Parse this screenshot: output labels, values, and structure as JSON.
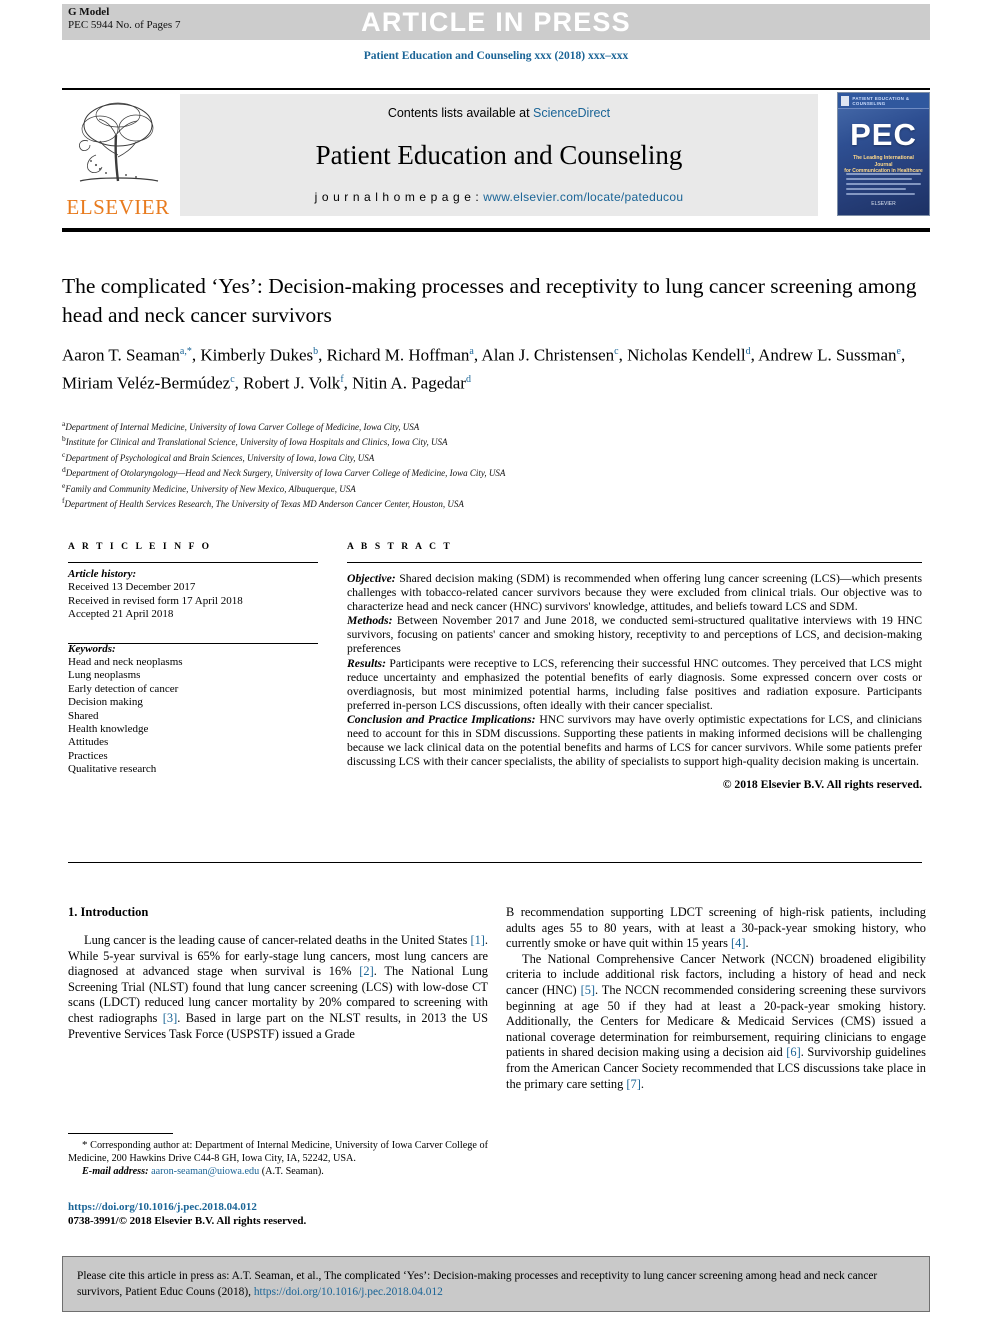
{
  "banner": {
    "text": "ARTICLE IN PRESS",
    "g_model_line1": "G Model",
    "g_model_line2": "PEC 5944 No. of Pages 7",
    "bg_color": "#cccccc"
  },
  "journal_ref": "Patient Education and Counseling xxx (2018) xxx–xxx",
  "masthead": {
    "publisher": "ELSEVIER",
    "publisher_color": "#E87B1E",
    "contents_prefix": "Contents lists available at ",
    "contents_link": "ScienceDirect",
    "journal_title": "Patient Education and Counseling",
    "homepage_label": "j o u r n a l  h o m e p a g e :  ",
    "homepage_url": "www.elsevier.com/locate/pateducou",
    "link_color": "#1a6496",
    "cover": {
      "header": "PATIENT EDUCATION & COUNSELING",
      "acronym": "PEC",
      "tagline_line1": "The Leading International Journal",
      "tagline_line2": "for Communication in Healthcare",
      "footer": "ELSEVIER"
    }
  },
  "article": {
    "title": "The complicated ‘Yes’: Decision-making processes and receptivity to lung cancer screening among head and neck cancer survivors",
    "authors_html": "Aaron T. Seaman<sup>a,*</sup>, Kimberly Dukes<sup>b</sup>, Richard M. Hoffman<sup>a</sup>, Alan J. Christensen<sup>c</sup>, Nicholas Kendell<sup>d</sup>, Andrew L. Sussman<sup>e</sup>, Miriam Veléz-Bermúdez<sup>c</sup>, Robert J. Volk<sup>f</sup>, Nitin A. Pagedar<sup>d</sup>",
    "affiliations": [
      {
        "mark": "a",
        "text": "Department of Internal Medicine, University of Iowa Carver College of Medicine, Iowa City, USA"
      },
      {
        "mark": "b",
        "text": "Institute for Clinical and Translational Science, University of Iowa Hospitals and Clinics, Iowa City, USA"
      },
      {
        "mark": "c",
        "text": "Department of Psychological and Brain Sciences, University of Iowa, Iowa City, USA"
      },
      {
        "mark": "d",
        "text": "Department of Otolaryngology—Head and Neck Surgery, University of Iowa Carver College of Medicine, Iowa City, USA"
      },
      {
        "mark": "e",
        "text": "Family and Community Medicine, University of New Mexico, Albuquerque, USA"
      },
      {
        "mark": "f",
        "text": "Department of Health Services Research, The University of Texas MD Anderson Cancer Center, Houston, USA"
      }
    ]
  },
  "article_info": {
    "heading": "A R T I C L E   I N F O",
    "history_label": "Article history:",
    "history": [
      "Received 13 December 2017",
      "Received in revised form 17 April 2018",
      "Accepted 21 April 2018"
    ],
    "keywords_label": "Keywords:",
    "keywords": [
      "Head and neck neoplasms",
      "Lung neoplasms",
      "Early detection of cancer",
      "Decision making",
      "Shared",
      "Health knowledge",
      "Attitudes",
      "Practices",
      "Qualitative research"
    ]
  },
  "abstract": {
    "heading": "A B S T R A C T",
    "sections": [
      {
        "label": "Objective:",
        "text": " Shared decision making (SDM) is recommended when offering lung cancer screening (LCS)—which presents challenges with tobacco-related cancer survivors because they were excluded from clinical trials. Our objective was to characterize head and neck cancer (HNC) survivors' knowledge, attitudes, and beliefs toward LCS and SDM."
      },
      {
        "label": "Methods:",
        "text": " Between November 2017 and June 2018, we conducted semi-structured qualitative interviews with 19 HNC survivors, focusing on patients' cancer and smoking history, receptivity to and perceptions of LCS, and decision-making preferences"
      },
      {
        "label": "Results:",
        "text": " Participants were receptive to LCS, referencing their successful HNC outcomes. They perceived that LCS might reduce uncertainty and emphasized the potential benefits of early diagnosis. Some expressed concern over costs or overdiagnosis, but most minimized potential harms, including false positives and radiation exposure. Participants preferred in-person LCS discussions, often ideally with their cancer specialist."
      },
      {
        "label": "Conclusion and Practice Implications:",
        "text": " HNC survivors may have overly optimistic expectations for LCS, and clinicians need to account for this in SDM discussions. Supporting these patients in making informed decisions will be challenging because we lack clinical data on the potential benefits and harms of LCS for cancer survivors. While some patients prefer discussing LCS with their cancer specialists, the ability of specialists to support high-quality decision making is uncertain."
      }
    ],
    "copyright": "© 2018 Elsevier B.V. All rights reserved."
  },
  "body": {
    "section_heading": "1. Introduction",
    "left_paragraphs": [
      "Lung cancer is the leading cause of cancer-related deaths in the United States [1]. While 5-year survival is 65% for early-stage lung cancers, most lung cancers are diagnosed at advanced stage when survival is 16% [2]. The National Lung Screening Trial (NLST) found that lung cancer screening (LCS) with low-dose CT scans (LDCT) reduced lung cancer mortality by 20% compared to screening with chest radiographs [3]. Based in large part on the NLST results, in 2013 the US Preventive Services Task Force (USPSTF) issued a Grade"
    ],
    "right_paragraphs": [
      "B recommendation supporting LDCT screening of high-risk patients, including adults ages 55 to 80 years, with at least a 30-pack-year smoking history, who currently smoke or have quit within 15 years [4].",
      "The National Comprehensive Cancer Network (NCCN) broadened eligibility criteria to include additional risk factors, including a history of head and neck cancer (HNC) [5]. The NCCN recommended considering screening these survivors beginning at age 50 if they had at least a 20-pack-year smoking history. Additionally, the Centers for Medicare & Medicaid Services (CMS) issued a national coverage determination for reimbursement, requiring clinicians to engage patients in shared decision making using a decision aid [6]. Survivorship guidelines from the American Cancer Society recommended that LCS discussions take place in the primary care setting [7]."
    ],
    "citation_refs": [
      "[1]",
      "[2]",
      "[3]",
      "[4]",
      "[5]",
      "[6]",
      "[7]"
    ]
  },
  "footnote": {
    "marker": "*",
    "corresponding": "Corresponding author at: Department of Internal Medicine, University of Iowa Carver College of Medicine, 200 Hawkins Drive C44-8 GH, Iowa City, IA, 52242, USA.",
    "email_label": "E-mail address:",
    "email": "aaron-seaman@uiowa.edu",
    "email_author": "(A.T. Seaman)."
  },
  "doi": {
    "url": "https://doi.org/10.1016/j.pec.2018.04.012",
    "issn_line": "0738-3991/© 2018 Elsevier B.V. All rights reserved."
  },
  "cite_box": {
    "text_before": "Please cite this article in press as: A.T. Seaman, et al., The complicated ‘Yes’: Decision-making processes and receptivity to lung cancer screening among head and neck cancer survivors, Patient Educ Couns (2018), ",
    "link": "https://doi.org/10.1016/j.pec.2018.04.012",
    "bg_color": "#c9c9c9"
  }
}
